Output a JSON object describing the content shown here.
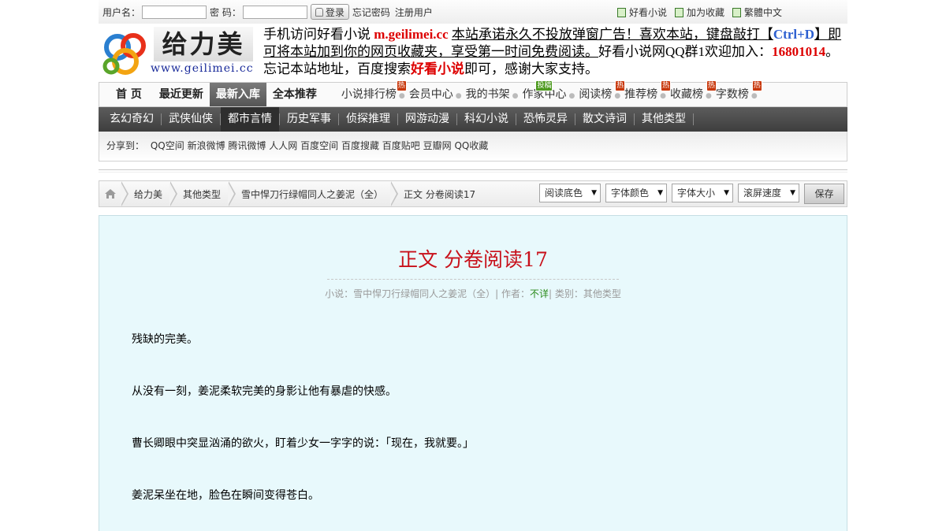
{
  "login": {
    "username_label": "用户名：",
    "password_label": "密  码：",
    "login_button": "登录",
    "forgot_link": "忘记密码",
    "register_link": "注册用户"
  },
  "top_links": [
    "好看小说",
    "加为收藏",
    "繁體中文"
  ],
  "logo": {
    "title": "给力美",
    "url": "www.geilimei.cc"
  },
  "notice": {
    "p1": "手机访问好看小说 ",
    "site": "m.geilimei.cc",
    "p2": " ",
    "promise": "本站承诺永久不投放弹窗广告！喜欢本站，键盘敲打【",
    "key": "Ctrl+D",
    "promise2": "】即可将本站加到你的网页收藏夹，享受第一时间免费阅读。",
    "p3": "好看小说网QQ群1欢迎加入：",
    "qq": "16801014",
    "p4": "。忘记本站地址，百度搜索",
    "search": "好看小说",
    "p5": "即可，感谢大家支持。"
  },
  "nav": {
    "tabs": [
      "首 页",
      "最近更新",
      "最新入库",
      "全本推荐"
    ],
    "active_tab": "最新入库",
    "subs": [
      {
        "label": "小说排行榜",
        "tag": "热"
      },
      {
        "label": "会员中心",
        "tag": ""
      },
      {
        "label": "我的书架",
        "tag": ""
      },
      {
        "label": "作家中心",
        "tag": "投稿"
      },
      {
        "label": "阅读榜",
        "tag": "热"
      },
      {
        "label": "推荐榜",
        "tag": "热"
      },
      {
        "label": "收藏榜",
        "tag": "热"
      },
      {
        "label": "字数榜",
        "tag": "热"
      }
    ]
  },
  "categories": [
    "玄幻奇幻",
    "武侠仙侠",
    "都市言情",
    "历史军事",
    "侦探推理",
    "网游动漫",
    "科幻小说",
    "恐怖灵异",
    "散文诗词",
    "其他类型"
  ],
  "active_category": "都市言情",
  "share": {
    "label": "分享到：",
    "items": [
      "QQ空间",
      "新浪微博",
      "腾讯微博",
      "人人网",
      "百度空间",
      "百度搜藏",
      "百度贴吧",
      "豆瓣网",
      "QQ收藏"
    ]
  },
  "breadcrumb": [
    "给力美",
    "其他类型",
    "雪中悍刀行绿帽同人之姜泥（全）",
    "正文 分卷阅读17"
  ],
  "reader_tools": {
    "selects": [
      "阅读底色",
      "字体颜色",
      "字体大小",
      "滚屏速度"
    ],
    "save": "保存"
  },
  "chapter": {
    "title": "正文 分卷阅读17",
    "info_novel_label": "小说：",
    "novel": "雪中悍刀行绿帽同人之姜泥（全）",
    "info_author_label": "| 作者：",
    "author": "不详",
    "info_type_label": "| 类别：",
    "type": "其他类型",
    "paragraphs": [
      "残缺的完美。",
      "从没有一刻，姜泥柔软完美的身影让他有暴虐的快感。",
      "曹长卿眼中突显汹涌的欲火，盯着少女一字字的说：「现在，我就要。」",
      "姜泥呆坐在地，脸色在瞬间变得苍白。"
    ]
  },
  "colors": {
    "accent_red": "#c8101a",
    "nav_dark": "#4a4a4a",
    "content_bg": "#e8f9fc"
  }
}
